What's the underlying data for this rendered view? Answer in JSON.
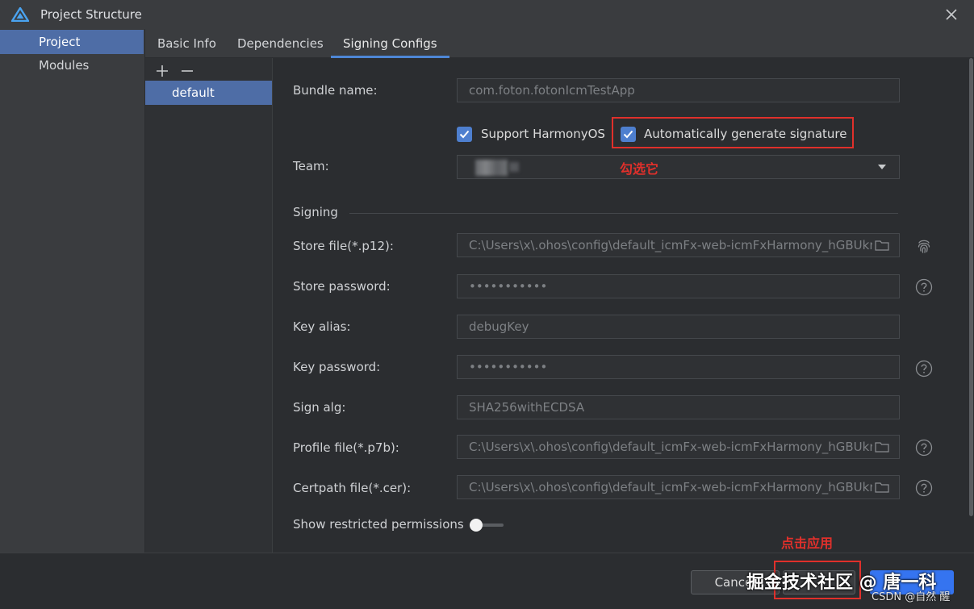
{
  "window": {
    "title": "Project Structure"
  },
  "nav": {
    "items": [
      {
        "label": "Project",
        "selected": true
      },
      {
        "label": "Modules",
        "selected": false
      }
    ]
  },
  "tabs": [
    {
      "label": "Basic Info"
    },
    {
      "label": "Dependencies"
    },
    {
      "label": "Signing Configs",
      "active": true
    }
  ],
  "configs": {
    "items": [
      "default"
    ]
  },
  "form": {
    "bundle_name": {
      "label": "Bundle name:",
      "value": "com.foton.fotonIcmTestApp"
    },
    "support_harmonyos": {
      "label": "Support HarmonyOS",
      "checked": true
    },
    "auto_sign": {
      "label": "Automatically generate signature",
      "checked": true
    },
    "team": {
      "label": "Team:"
    },
    "signing_section": "Signing",
    "store_file": {
      "label": "Store file(*.p12):",
      "value": "C:\\Users\\x\\.ohos\\config\\default_icmFx-web-icmFxHarmony_hGBUkn("
    },
    "store_password": {
      "label": "Store password:",
      "value": "•••••••••••"
    },
    "key_alias": {
      "label": "Key alias:",
      "value": "debugKey"
    },
    "key_password": {
      "label": "Key password:",
      "value": "•••••••••••"
    },
    "sign_alg": {
      "label": "Sign alg:",
      "value": "SHA256withECDSA"
    },
    "profile_file": {
      "label": "Profile file(*.p7b):",
      "value": "C:\\Users\\x\\.ohos\\config\\default_icmFx-web-icmFxHarmony_hGBUkn("
    },
    "certpath_file": {
      "label": "Certpath file(*.cer):",
      "value": "C:\\Users\\x\\.ohos\\config\\default_icmFx-web-icmFxHarmony_hGBUkn("
    },
    "restricted": {
      "label": "Show restricted permissions",
      "on": false
    }
  },
  "buttons": {
    "cancel": "Cancel"
  },
  "annotations": {
    "check_it": "勾选它",
    "click_apply": "点击应用"
  },
  "watermark": {
    "main": "掘金技术社区 @ 唐一科",
    "sub": "CSDN @自然 醒"
  },
  "colors": {
    "accent": "#4e6da6",
    "primary_button": "#3574f0",
    "annotation": "#e0302b"
  }
}
